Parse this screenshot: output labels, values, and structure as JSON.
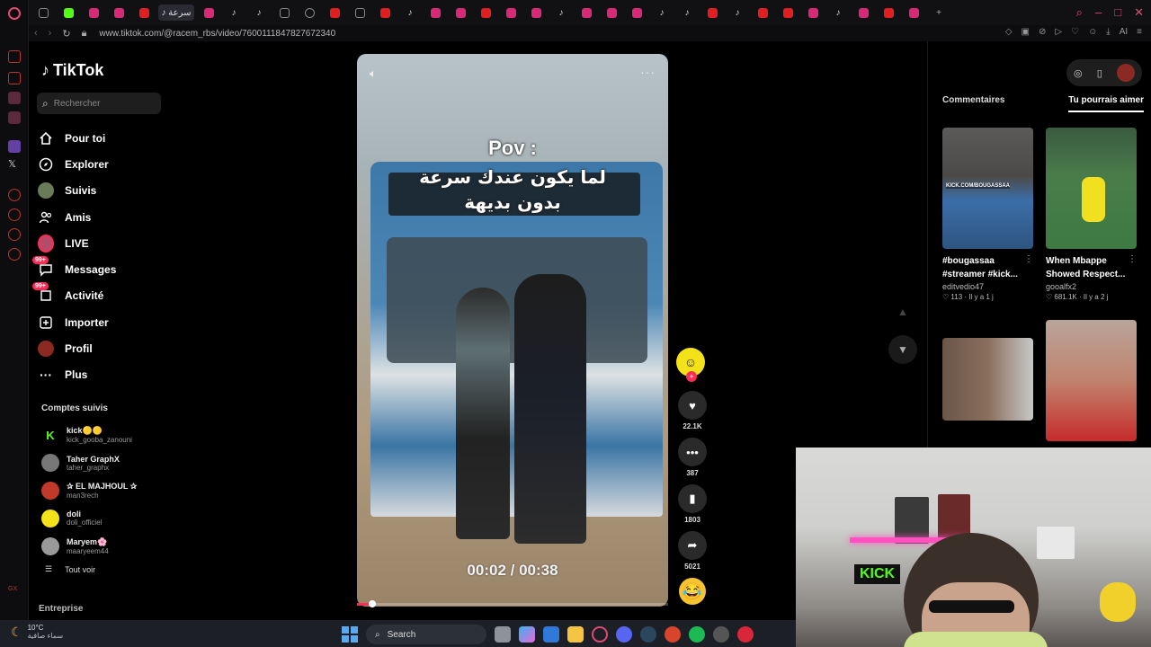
{
  "browser": {
    "url": "www.tiktok.com/@racem_rbs/video/7600111847827672340",
    "active_tab_label": "سرعة"
  },
  "tiktok": {
    "brand": "TikTok",
    "search_placeholder": "Rechercher",
    "nav": [
      {
        "label": "Pour toi",
        "icon": "home-icon"
      },
      {
        "label": "Explorer",
        "icon": "compass-icon"
      },
      {
        "label": "Suivis",
        "icon": "avatar-icon"
      },
      {
        "label": "Amis",
        "icon": "friends-icon"
      },
      {
        "label": "LIVE",
        "icon": "live-avatar-icon"
      },
      {
        "label": "Messages",
        "icon": "message-icon",
        "badge": "99+"
      },
      {
        "label": "Activité",
        "icon": "activity-icon",
        "badge": "99+"
      },
      {
        "label": "Importer",
        "icon": "upload-icon"
      },
      {
        "label": "Profil",
        "icon": "profile-avatar-icon"
      },
      {
        "label": "Plus",
        "icon": "more-icon"
      }
    ],
    "followed_title": "Comptes suivis",
    "followed": [
      {
        "name": "kick🟡🟡",
        "user": "kick_gooba_zanouni",
        "color": "#53fc18"
      },
      {
        "name": "Taher GraphX",
        "user": "taher_graphx",
        "color": "#777777"
      },
      {
        "name": "✰ EL MAJHOUL ✰",
        "user": "man3rech",
        "color": "#c0392b"
      },
      {
        "name": "doli",
        "user": "doli_officiel",
        "color": "#f3e21a"
      },
      {
        "name": "Maryem🌸",
        "user": "maaryeem44",
        "color": "#999999"
      }
    ],
    "see_all": "Tout voir",
    "footer_label": "Entreprise"
  },
  "video": {
    "overlay_title": "Pov :",
    "overlay_line1": "لما يكون عندك سرعة",
    "overlay_line2": "بدون بديهة",
    "time": "00:02 / 00:38",
    "progress": 0.05,
    "more_label": "···"
  },
  "actions": {
    "likes": "22.1K",
    "comments": "387",
    "saves": "1803",
    "shares": "5021"
  },
  "right_panel": {
    "tabs": [
      "Commentaires",
      "Tu pourrais aimer"
    ],
    "active_tab": "Tu pourrais aimer",
    "cards": [
      {
        "title": "#bougassaa #streamer #kick...",
        "user": "editvedio47",
        "meta": "♡ 113 · Il y a 1 j",
        "thumb_text": "KICK.COM/BOUGASSAA"
      },
      {
        "title": "When Mbappe Showed Respect...",
        "user": "gooalfx2",
        "meta": "♡ 681.1K · Il y a 2 j"
      }
    ]
  },
  "webcam": {
    "sign_text": "KICK"
  },
  "taskbar": {
    "temp": "10°C",
    "weather_desc": "سماء صافية",
    "search_label": "Search"
  },
  "colors": {
    "accent": "#fe2c55",
    "kick_green": "#53fc18",
    "opera_red": "#e04a72"
  }
}
